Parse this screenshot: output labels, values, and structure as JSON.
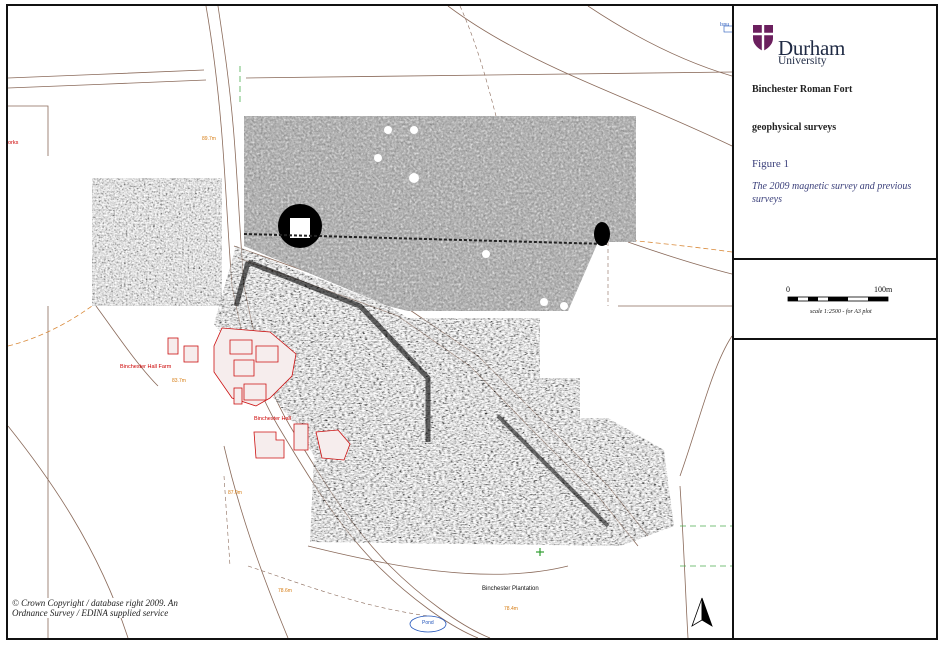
{
  "institution": {
    "name": "Durham",
    "sub": "University"
  },
  "figure": {
    "site": "Binchester Roman Fort",
    "subtitle": "geophysical surveys",
    "number_label": "Figure 1",
    "caption": "The 2009 magnetic survey and previous surveys"
  },
  "scale_bar": {
    "zero": "0",
    "max": "100m",
    "note": "scale 1:2500 - for A3 plot"
  },
  "copyright": "© Crown Copyright / database right 2009. An Ordnance Survey / EDINA supplied service",
  "map_labels": {
    "farm": "Binchester Hall Farm",
    "hall": "Binchester Hall",
    "plantation": "Binchester Plantation",
    "pond": "Pond",
    "works": "orks",
    "spot_1": "89.7m",
    "spot_2": "83.7m",
    "spot_3": "87.0m",
    "spot_4": "78.6m",
    "spot_5": "78.4m",
    "corner": "Issu"
  },
  "icons": {
    "north": "north-arrow-icon",
    "benchmark": "green-cross-icon",
    "logo": "durham-shield-icon"
  },
  "colors": {
    "buildings": "#cc1111",
    "roads": "#8a6a5a",
    "spot_heights": "#d67c12",
    "caption": "#3a3f7a",
    "logo": "#6b1f5e"
  }
}
